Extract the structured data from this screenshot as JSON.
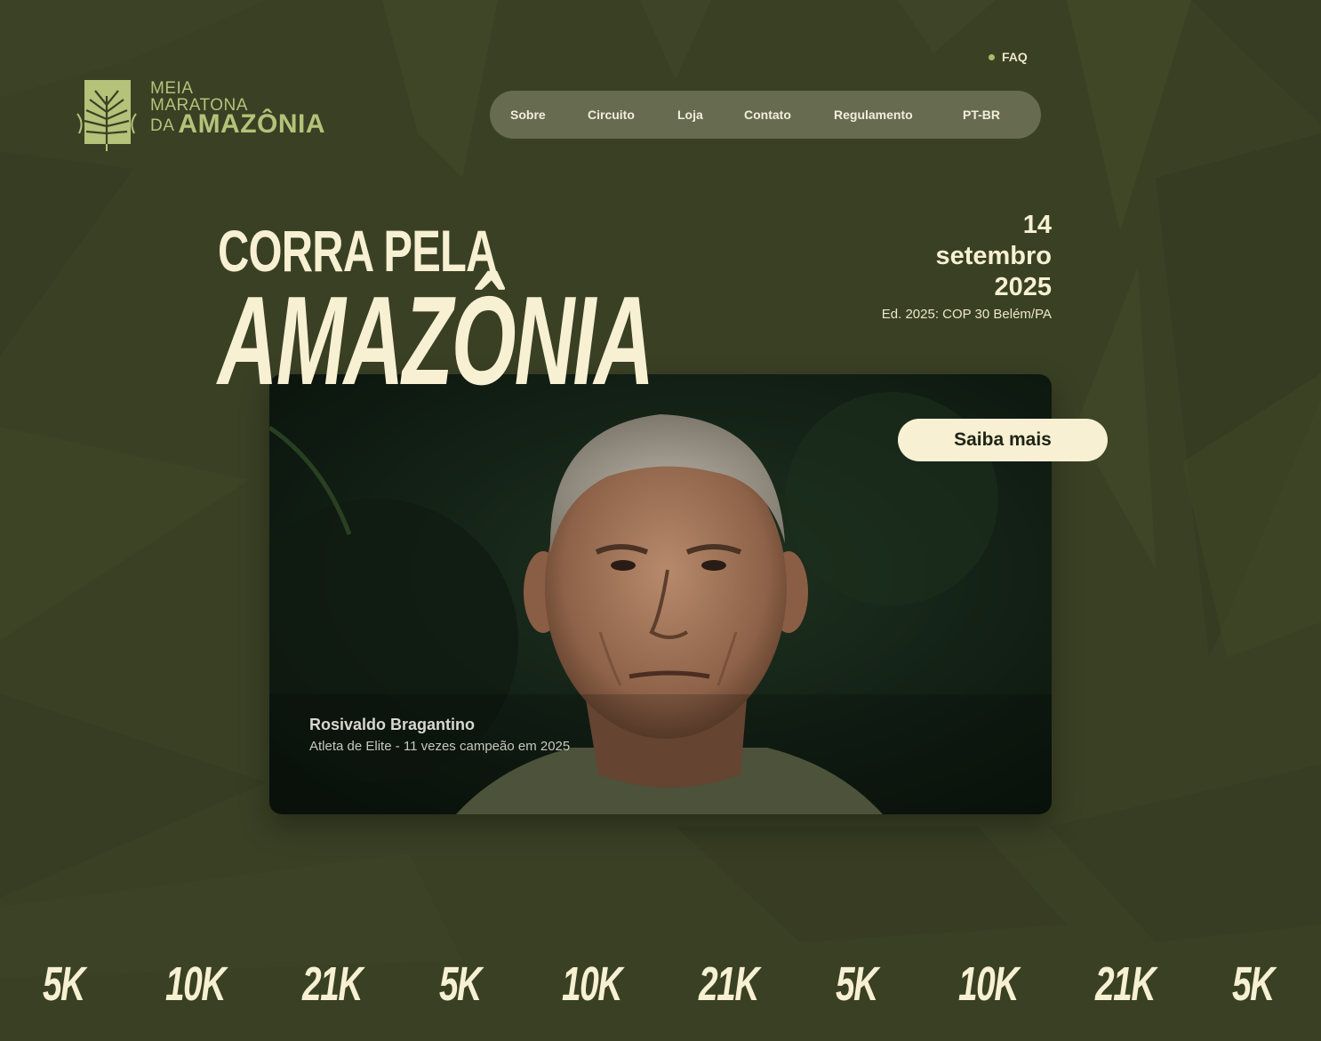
{
  "colors": {
    "background": "#3a4024",
    "logo": "#b4c27a",
    "cream": "#f7f0d3",
    "nav_bg": "#7e846a",
    "faq_dot": "#a9bb6c"
  },
  "logo": {
    "icon": "palm-leaf-logo-icon",
    "line1": "MEIA",
    "line2": "MARATONA",
    "line3_small": "DA",
    "line3_big": "AMAZÔNIA"
  },
  "header": {
    "faq_label": "FAQ",
    "nav": [
      {
        "label": "Sobre"
      },
      {
        "label": "Circuito"
      },
      {
        "label": "Loja"
      },
      {
        "label": "Contato"
      },
      {
        "label": "Regulamento"
      },
      {
        "label": "PT-BR"
      }
    ]
  },
  "hero": {
    "title_line1": "CORRA PELA",
    "title_line2": "AMAZÔNIA",
    "date_day": "14",
    "date_month": "setembro",
    "date_year": "2025",
    "edition": "Ed. 2025: COP 30 Belém/PA",
    "cta_label": "Saiba mais"
  },
  "video": {
    "person_name": "Rosivaldo Bragantino",
    "person_subtitle": "Atleta de Elite - 11 vezes campeão em 2025"
  },
  "distances": [
    "5K",
    "10K",
    "21K",
    "5K",
    "10K",
    "21K",
    "5K",
    "10K",
    "21K",
    "5K"
  ]
}
